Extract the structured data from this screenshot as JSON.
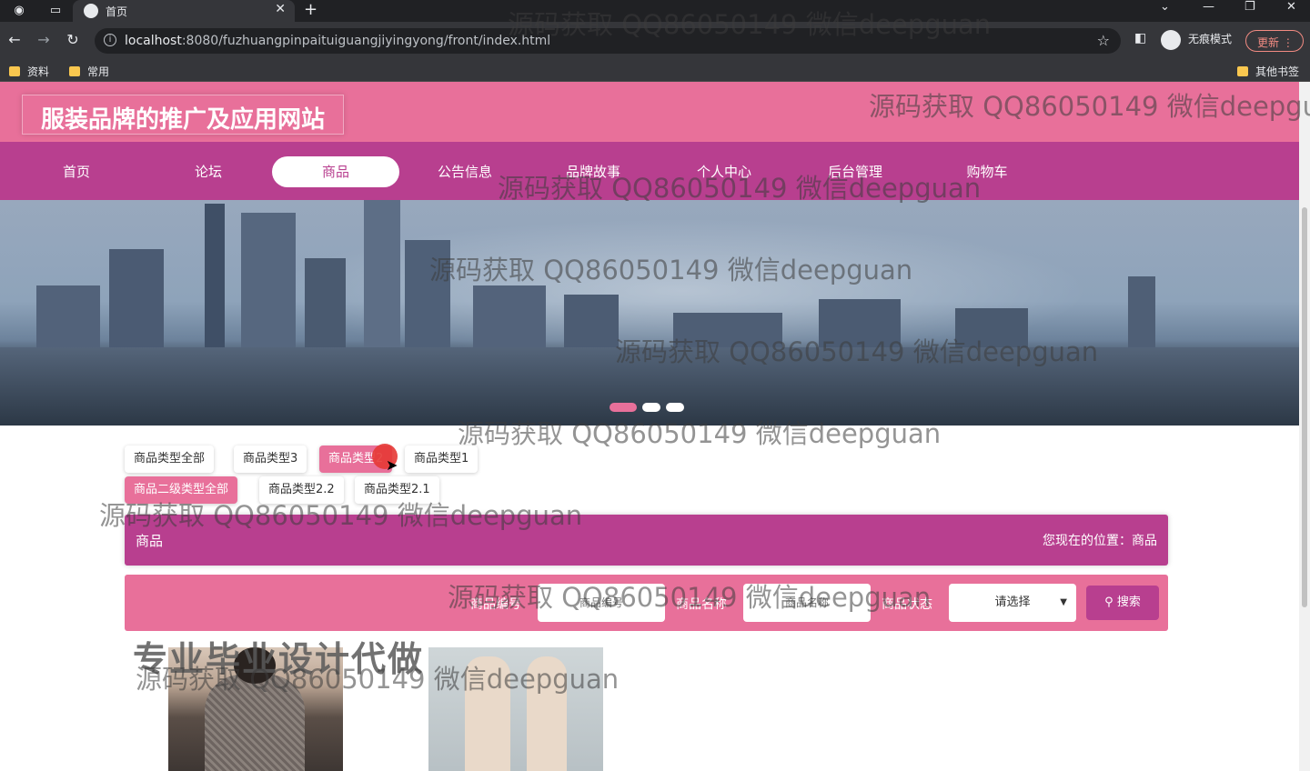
{
  "browser": {
    "tab_title": "首页",
    "url_host": "localhost",
    "url_rest": ":8080/fuzhuangpinpaituiguangjiyingyong/front/index.html",
    "incognito_label": "无痕模式",
    "update_label": "更新",
    "bookmarks": [
      "资料",
      "常用"
    ],
    "other_bookmarks": "其他书签"
  },
  "site": {
    "title": "服装品牌的推广及应用网站",
    "nav": [
      "首页",
      "论坛",
      "商品",
      "公告信息",
      "品牌故事",
      "个人中心",
      "后台管理",
      "购物车"
    ],
    "active_nav": "商品"
  },
  "filters": {
    "row1": [
      "商品类型全部",
      "商品类型3",
      "商品类型2",
      "商品类型1"
    ],
    "row1_active": "商品类型2",
    "row2": [
      "商品二级类型全部",
      "商品类型2.2",
      "商品类型2.1"
    ],
    "row2_active": "商品二级类型全部"
  },
  "location": {
    "section": "商品",
    "breadcrumb": "您现在的位置：商品"
  },
  "search": {
    "code_label": "商品编号",
    "code_placeholder": "商品编号",
    "name_label": "商品名称",
    "name_placeholder": "商品名称",
    "status_label": "商品状态",
    "status_selected": "请选择",
    "search_button": "搜索"
  },
  "overlay": {
    "watermark": "源码获取 QQ86050149 微信deepguan",
    "promo": "专业毕业设计代做"
  },
  "colors": {
    "header_pink": "#e8709a",
    "nav_magenta": "#b83f8f"
  }
}
